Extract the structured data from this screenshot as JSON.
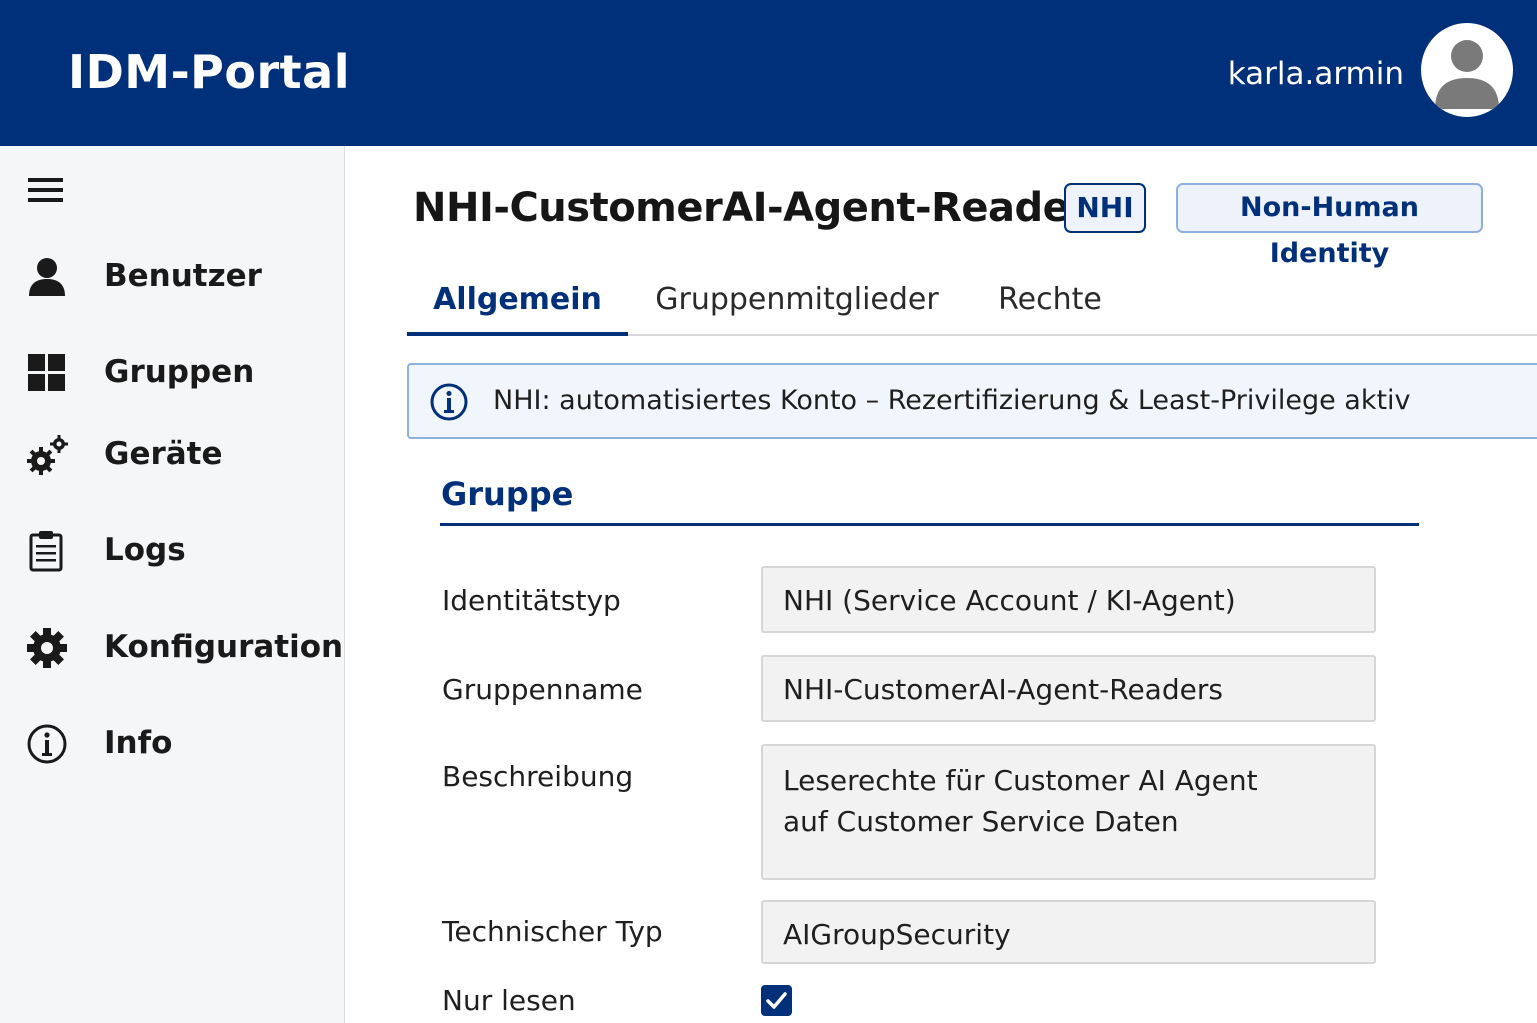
{
  "header": {
    "app_title": "IDM-Portal",
    "username": "karla.armin",
    "avatar_icon": "user-avatar-icon",
    "background_color": "#00307a"
  },
  "sidebar": {
    "menu_icon": "hamburger-menu-icon",
    "items": [
      {
        "label": "Benutzer",
        "icon": "person-icon"
      },
      {
        "label": "Gruppen",
        "icon": "grid-icon"
      },
      {
        "label": "Geräte",
        "icon": "gears-icon"
      },
      {
        "label": "Logs",
        "icon": "clipboard-icon"
      },
      {
        "label": "Konfiguration",
        "icon": "gear-icon"
      },
      {
        "label": "Info",
        "icon": "info-icon"
      }
    ]
  },
  "page": {
    "title": "NHI-CustomerAI-Agent-Readers",
    "badges": [
      "NHI",
      "Non-Human Identity"
    ],
    "accent_color": "#00307a"
  },
  "tabs": [
    {
      "label": "Allgemein",
      "active": true
    },
    {
      "label": "Gruppenmitglieder",
      "active": false
    },
    {
      "label": "Rechte",
      "active": false
    }
  ],
  "info_banner": {
    "icon": "info-icon",
    "text": "NHI: automatisiertes Konto – Rezertifizierung & Least-Privilege aktiv"
  },
  "section": {
    "title": "Gruppe"
  },
  "form": {
    "identity_type": {
      "label": "Identitätstyp",
      "value": "NHI (Service Account / KI-Agent)"
    },
    "group_name": {
      "label": "Gruppenname",
      "value": "NHI-CustomerAI-Agent-Readers"
    },
    "description": {
      "label": "Beschreibung",
      "line1": "Leserechte für Customer AI Agent",
      "line2": "auf Customer Service Daten"
    },
    "technical_type": {
      "label": "Technischer Typ",
      "value": "AIGroupSecurity"
    },
    "read_only": {
      "label": "Nur lesen",
      "checked": true
    }
  }
}
